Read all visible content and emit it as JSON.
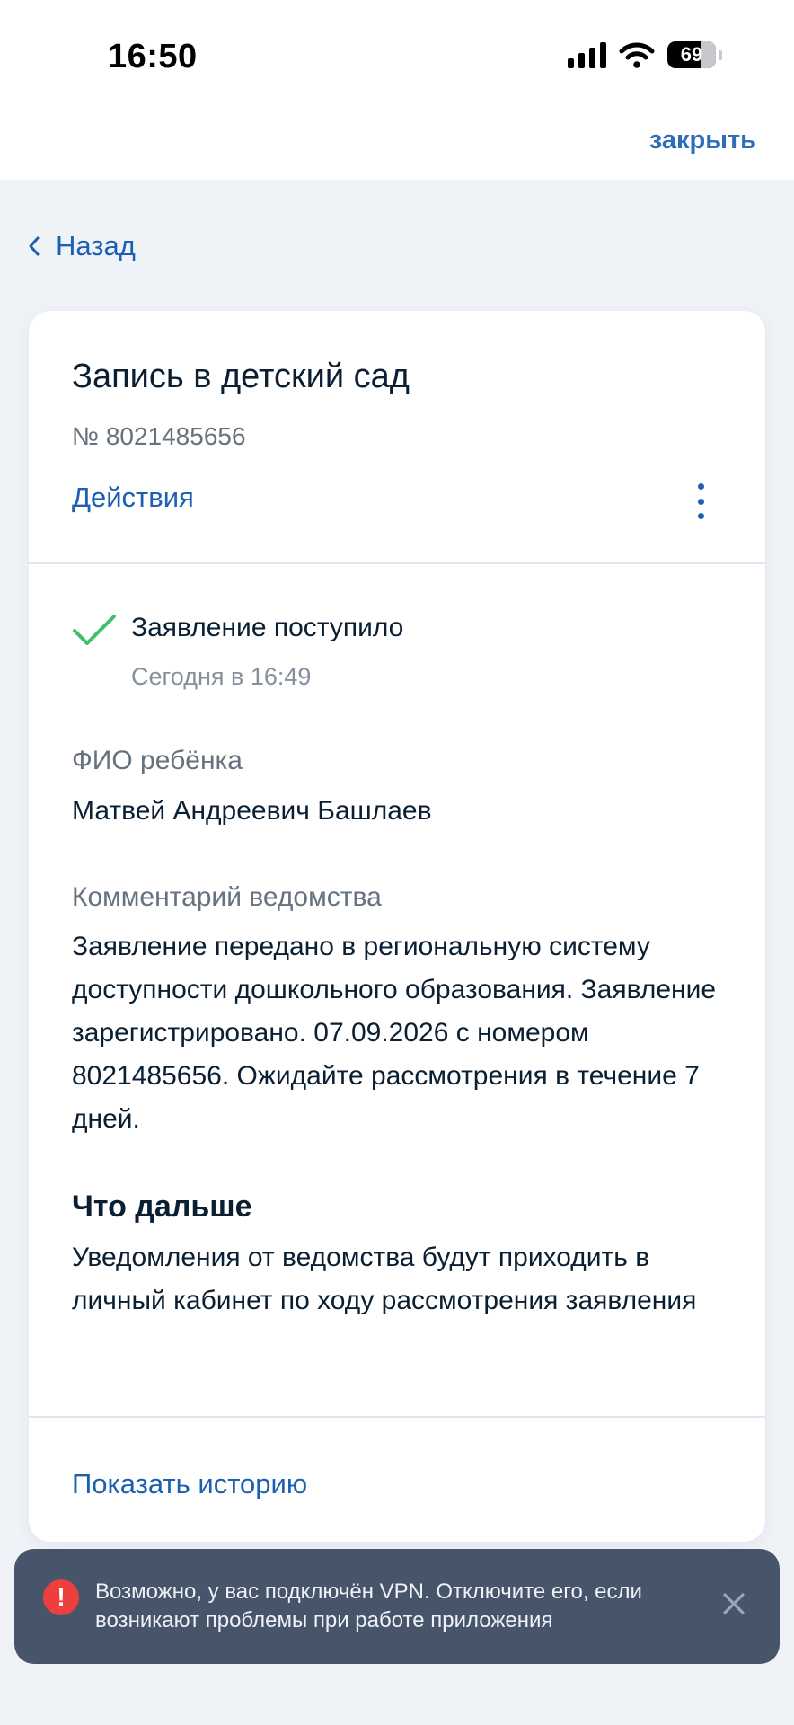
{
  "status_bar": {
    "time": "16:50",
    "battery_level": "69",
    "icons": [
      "signal-icon",
      "wifi-icon",
      "battery-icon"
    ]
  },
  "app_bar": {
    "close_label": "закрыть"
  },
  "nav": {
    "back_label": "Назад"
  },
  "application": {
    "title": "Запись в детский сад",
    "number": "№ 8021485656",
    "actions_label": "Действия",
    "status": {
      "title": "Заявление поступило",
      "time": "Сегодня в 16:49"
    },
    "child_name_label": "ФИО ребёнка",
    "child_name": "Матвей Андреевич Башлаев",
    "comment_label": "Комментарий ведомства",
    "comment": "Заявление передано в региональную систему доступности дошкольного образования. Заявление зарегистрировано. 07.09.2026 с номером 8021485656. Ожидайте рассмотрения в течение 7 дней.",
    "next_title": "Что дальше",
    "next_text": "Уведомления от ведомства будут приходить в личный кабинет по ходу рассмотрения заявления",
    "history_link": "Показать историю"
  },
  "toast": {
    "icon_symbol": "!",
    "text": "Возможно, у вас подключён VPN. Отключите его, если возникают проблемы при работе приложения"
  },
  "colors": {
    "accent": "#1d5fb1",
    "success": "#3cbf6f",
    "error": "#ee3f3f",
    "toast_background": "#47556a",
    "page_background": "#eff3f8"
  }
}
